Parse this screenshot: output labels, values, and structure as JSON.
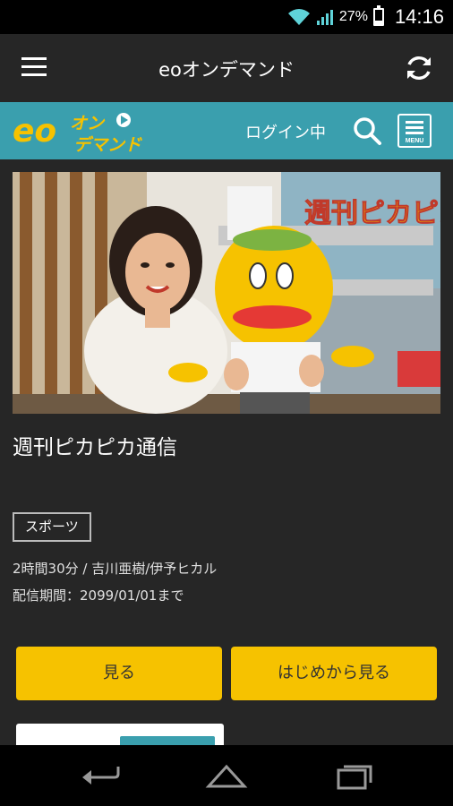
{
  "status_bar": {
    "battery": "27%",
    "battery_level": 0.27,
    "time": "14:16"
  },
  "app_bar": {
    "title": "eoオンデマンド"
  },
  "brand_bar": {
    "logo_text_main": "eo",
    "logo_text_sub1": "オン",
    "logo_text_sub2": "デマンド",
    "login_status": "ログイン中",
    "menu_label": "MENU"
  },
  "program": {
    "hero_title_text": "週刊ピカピカ通信",
    "title": "週刊ピカピカ通信",
    "genre": "スポーツ",
    "duration_cast": "2時間30分 / 吉川亜樹/伊予ヒカル",
    "availability": "配信期間：2099/01/01まで"
  },
  "actions": {
    "watch": "見る",
    "watch_from_start": "はじめから見る"
  },
  "colors": {
    "brand_teal": "#3a9fae",
    "accent_yellow": "#f6c200",
    "background": "#262626"
  }
}
